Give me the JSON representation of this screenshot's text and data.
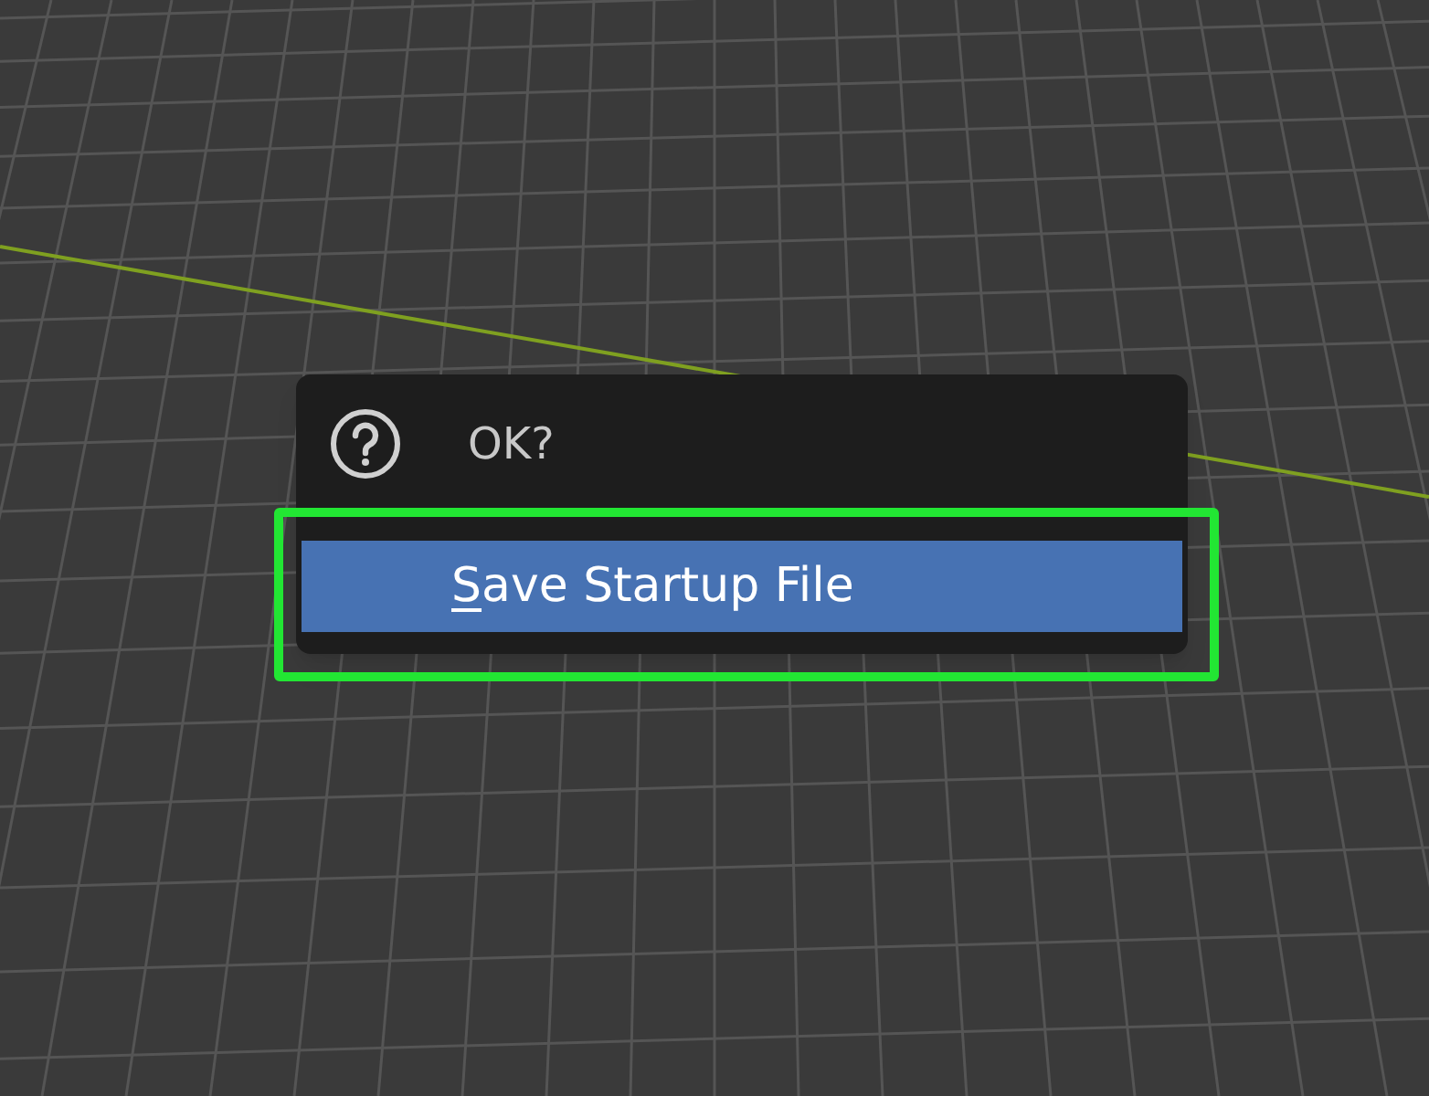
{
  "popup": {
    "title": "OK?",
    "items": [
      {
        "label": "Save Startup File",
        "selected": true,
        "mnemonic": true
      }
    ]
  },
  "highlight": {
    "on": true
  }
}
